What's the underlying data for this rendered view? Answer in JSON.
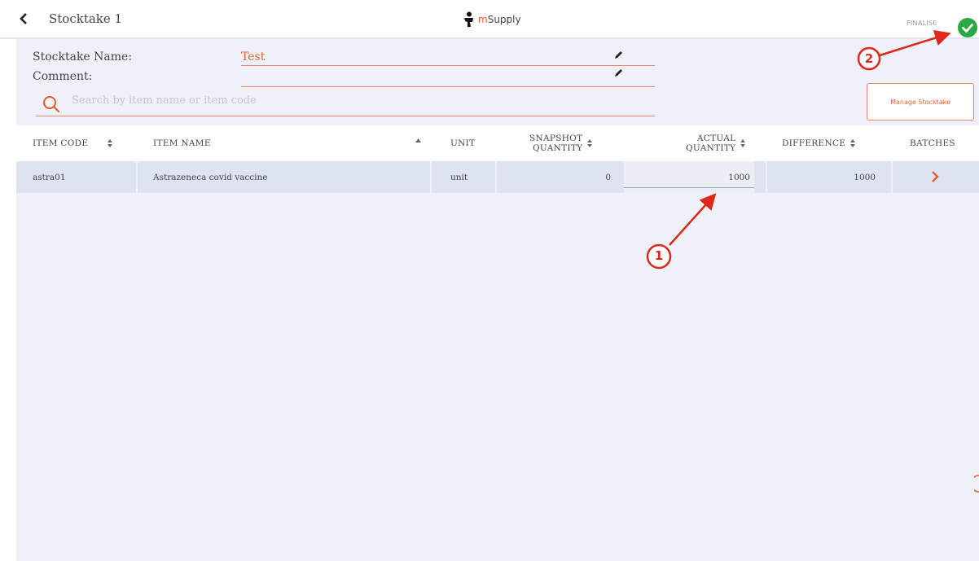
{
  "header": {
    "title": "Stocktake 1",
    "brand": {
      "prefix": "m",
      "name": "Supply"
    },
    "finalise_label": "FINALISE"
  },
  "form": {
    "name_label": "Stocktake Name:",
    "name_value": "Test",
    "comment_label": "Comment:",
    "comment_value": "",
    "search_placeholder": "Search by item name or item code",
    "manage_button": "Manage Stocktake"
  },
  "table": {
    "columns": {
      "item_code": "ITEM CODE",
      "item_name": "ITEM NAME",
      "unit": "UNIT",
      "snapshot_1": "SNAPSHOT",
      "snapshot_2": "QUANTITY",
      "actual_1": "ACTUAL",
      "actual_2": "QUANTITY",
      "difference": "DIFFERENCE",
      "batches": "BATCHES"
    },
    "rows": [
      {
        "item_code": "astra01",
        "item_name": "Astrazeneca covid vaccine",
        "unit": "unit",
        "snapshot_quantity": "0",
        "actual_quantity": "1000",
        "difference": "1000"
      }
    ]
  },
  "annotations": {
    "marker_1": "1",
    "marker_2": "2"
  },
  "colors": {
    "accent": "#e95c30",
    "finalise_green": "#2aa845",
    "annotation_red": "#e0281a",
    "content_bg": "#eef1f7",
    "row_bg": "#dde3f0"
  },
  "icons": [
    "chevron-left-icon",
    "msupply-logo-icon",
    "check-circle-icon",
    "pencil-icon",
    "search-icon",
    "sort-icon",
    "chevron-right-icon"
  ]
}
